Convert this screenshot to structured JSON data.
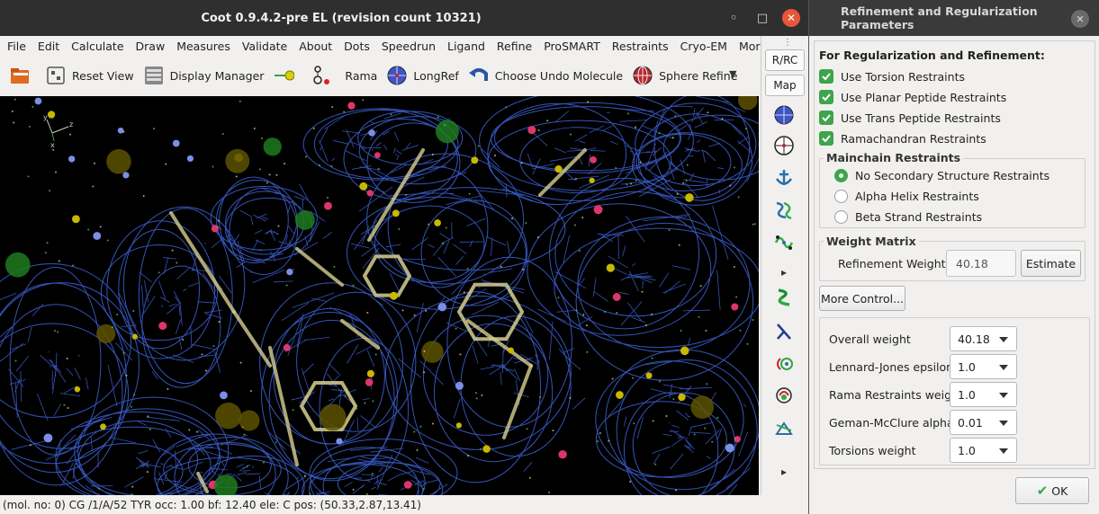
{
  "main_window": {
    "title": "Coot 0.9.4.2-pre EL (revision count 10321)",
    "min_glyph": "◦",
    "max_glyph": "□",
    "close_glyph": "✕"
  },
  "menubar": {
    "items": [
      "File",
      "Edit",
      "Calculate",
      "Draw",
      "Measures",
      "Validate",
      "About",
      "Dots",
      "Speedrun",
      "Ligand",
      "Refine",
      "ProSMART",
      "Restraints",
      "Cryo-EM",
      "Morph"
    ]
  },
  "toolbar": {
    "reset_view": "Reset View",
    "display_manager": "Display Manager",
    "rama": "Rama",
    "longref": "LongRef",
    "choose_undo": "Choose Undo Molecule",
    "sphere_refine": "Sphere Refine",
    "more_glyph": "▼"
  },
  "vertical_toolbar": {
    "rrc": "R/RC",
    "map": "Map",
    "dots": "⋮",
    "arrow1": "▸",
    "arrow2": "▸"
  },
  "axes": {
    "x": "x",
    "y": "y",
    "z": "z"
  },
  "statusbar": {
    "text": "(mol. no: 0)  CG /1/A/52 TYR occ: 1.00 bf: 12.40 ele:  C pos: (50.33,2.87,13.41)"
  },
  "dialog": {
    "title": "Refinement and Regularization Parameters",
    "close_glyph": "✕",
    "section_title": "For Regularization and Refinement:",
    "checkboxes": [
      {
        "label": "Use Torsion Restraints",
        "checked": true
      },
      {
        "label": "Use Planar Peptide Restraints",
        "checked": true
      },
      {
        "label": "Use Trans Peptide Restraints",
        "checked": true
      },
      {
        "label": "Ramachandran Restraints",
        "checked": true
      }
    ],
    "mainchain": {
      "title": "Mainchain Restraints",
      "options": [
        {
          "label": "No Secondary Structure Restraints",
          "selected": true
        },
        {
          "label": "Alpha Helix Restraints",
          "selected": false
        },
        {
          "label": "Beta Strand Restraints",
          "selected": false
        }
      ]
    },
    "weight_matrix": {
      "title": "Weight Matrix",
      "label": "Refinement Weight",
      "value": "40.18",
      "estimate": "Estimate"
    },
    "more_control": "More Control...",
    "params": [
      {
        "label": "Overall weight",
        "value": "40.18"
      },
      {
        "label": "Lennard-Jones epsilon",
        "value": "1.0"
      },
      {
        "label": "Rama Restraints weight",
        "value": "1.0"
      },
      {
        "label": "Geman-McClure alpha",
        "value": "0.01"
      },
      {
        "label": "Torsions weight",
        "value": "1.0"
      }
    ],
    "ok": "OK",
    "ok_glyph": "✔"
  },
  "colors": {
    "mesh": "#3f63d8",
    "background": "#000000",
    "bond": "#d8cf92",
    "carbon": "#c8b800",
    "oxygen": "#e0356b",
    "nitrogen": "#7b8fe8",
    "water": "#5fbf5f",
    "check_green": "#3fa44b"
  }
}
